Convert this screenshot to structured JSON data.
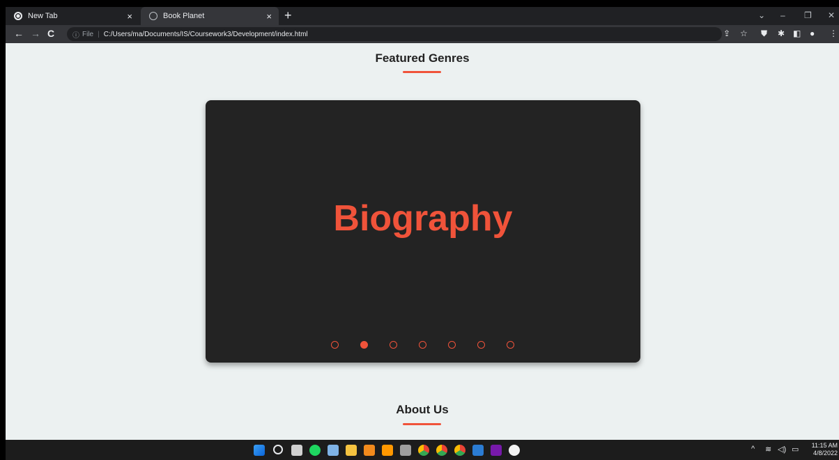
{
  "browser": {
    "tabs": [
      {
        "title": "New Tab",
        "active": false
      },
      {
        "title": "Book Planet",
        "active": true
      }
    ],
    "new_tab_symbol": "+",
    "close_symbol": "×",
    "url_prefix": "File",
    "url_separator": "|",
    "url": "C:/Users/ma/Documents/IS/Coursework3/Development/index.html",
    "nav": {
      "back": "←",
      "forward": "→",
      "reload": "C"
    },
    "window_controls": {
      "dropdown": "⌄",
      "minimize": "–",
      "restore": "❐",
      "close": "✕"
    },
    "toolbar_icons": {
      "share": "⇪",
      "star": "☆",
      "shield": "⛊",
      "extensions": "✱",
      "sidepanel": "◧",
      "profile": "●",
      "menu": "⋮"
    }
  },
  "page": {
    "featured_title": "Featured Genres",
    "about_title": "About Us",
    "carousel": {
      "current_slide_text": "Biography",
      "dot_count": 7,
      "active_index": 1
    }
  },
  "taskbar": {
    "time": "11:15 AM",
    "date": "4/8/2022",
    "tray": {
      "chevron": "^",
      "wifi": "≋",
      "volume": "◁)",
      "battery": "▭"
    }
  },
  "colors": {
    "accent": "#f0533a",
    "card": "#232323",
    "page_bg": "#ecf1f1"
  }
}
